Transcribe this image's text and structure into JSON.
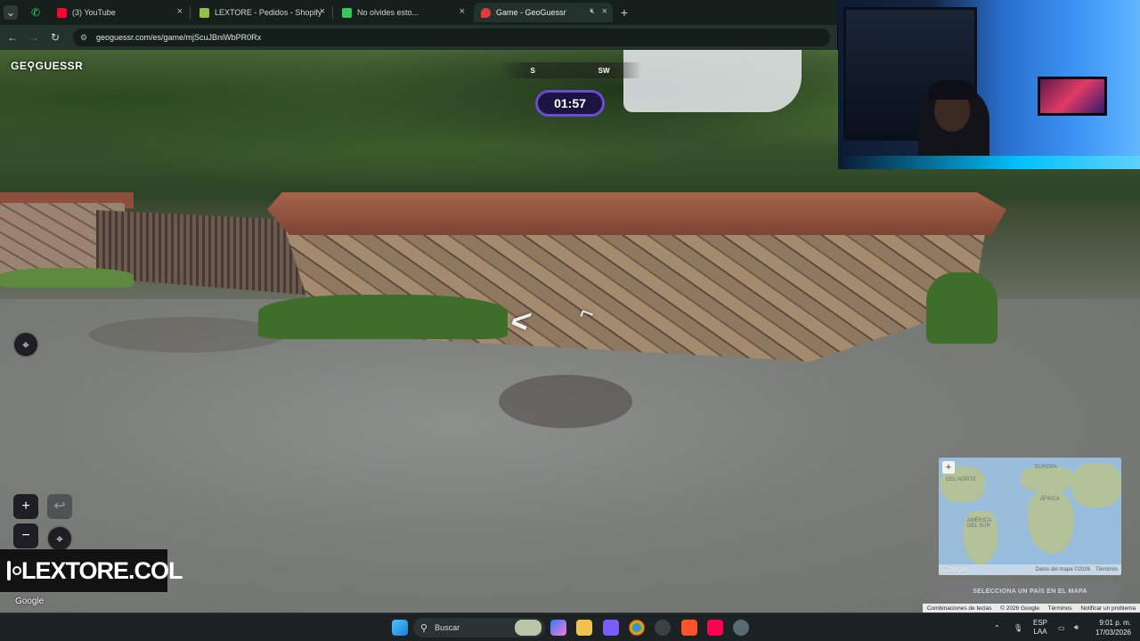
{
  "browser": {
    "tabs": [
      {
        "label": "(3) YouTube",
        "icon": "youtube-icon",
        "color": "#ff0033"
      },
      {
        "label": "LEXTORE - Pedidos - Shopify",
        "icon": "shopify-icon",
        "color": "#95bf47"
      },
      {
        "label": "No olvides esto...",
        "icon": "notion-icon",
        "color": "#34c759"
      },
      {
        "label": "Game - GeoGuessr",
        "icon": "geoguessr-icon",
        "color": "#e03a3a"
      }
    ],
    "url": "geoguessr.com/es/game/mjScuJBniWbPR0Rx"
  },
  "game": {
    "logo": "GE⚲GUESSR",
    "compass": [
      "S",
      "SW"
    ],
    "timer": "01:57",
    "zoom_in": "+",
    "zoom_out": "−",
    "undo": "↩",
    "google": "Google",
    "accent": "#6a4bd1"
  },
  "minimap": {
    "labels": {
      "europa": "EUROPA",
      "norte": "DEL NORTE",
      "africa": "ÁFRICA",
      "america_sur": "AMÉRICA DEL SUR"
    },
    "google": "Google",
    "attribution": "Datos del mapa ©2026",
    "terms": "Términos",
    "guess_button": "SELECCIONA UN PAÍS EN EL MAPA"
  },
  "footer": {
    "shortcuts": "Combinaciones de teclas",
    "copyright": "© 2026 Google",
    "terms": "Términos",
    "report": "Notificar un problema"
  },
  "overlay": {
    "instagram_handle": "LEXTORE.COL"
  },
  "taskbar": {
    "search": "Buscar",
    "lang_top": "ESP",
    "lang_bottom": "LAA",
    "time": "9:01 p. m.",
    "date": "17/03/2026"
  }
}
